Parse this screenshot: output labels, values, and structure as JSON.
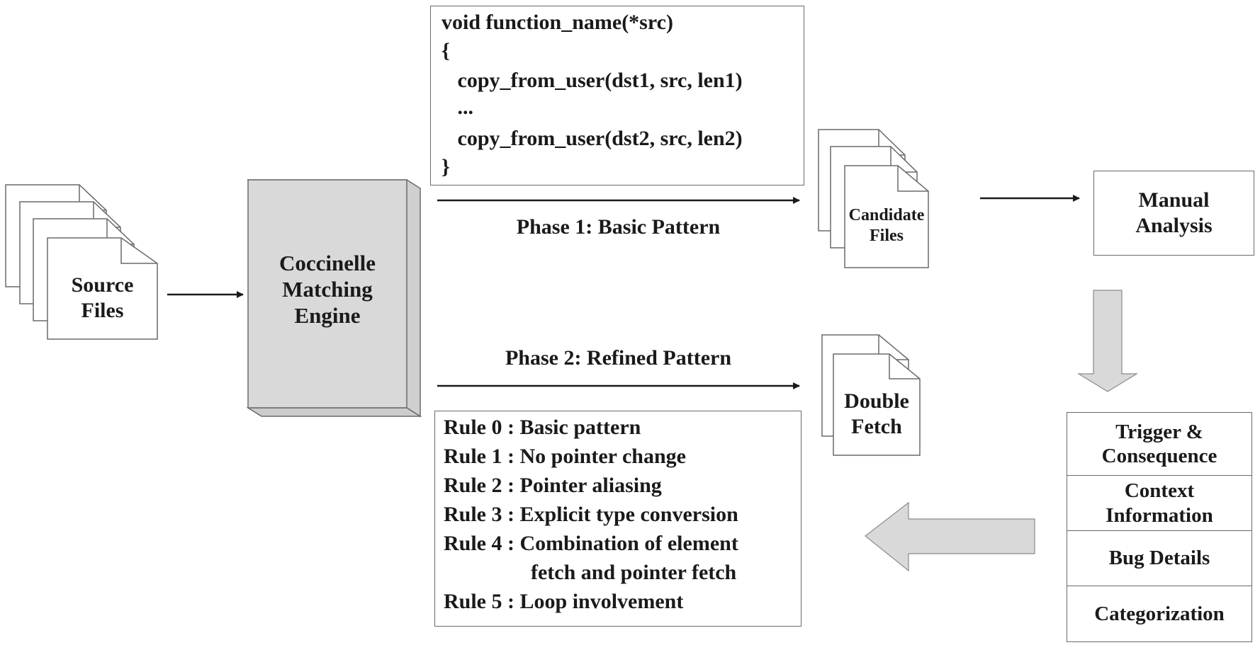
{
  "source_files": {
    "line1": "Source",
    "line2": "Files"
  },
  "engine": {
    "line1": "Coccinelle",
    "line2": "Matching",
    "line3": "Engine"
  },
  "basic_pattern_code": {
    "lines": [
      "void function_name(*src)",
      "{",
      "   copy_from_user(dst1, src, len1)",
      "   ...",
      "   copy_from_user(dst2, src, len2)",
      "}"
    ]
  },
  "phase1": {
    "label": "Phase 1: Basic Pattern"
  },
  "phase2": {
    "label": "Phase 2: Refined Pattern"
  },
  "candidate_files": {
    "line1": "Candidate",
    "line2": "Files"
  },
  "manual_analysis": {
    "line1": "Manual",
    "line2": "Analysis"
  },
  "double_fetch": {
    "line1": "Double",
    "line2": "Fetch"
  },
  "rules": {
    "items": [
      {
        "id": "Rule 0 :",
        "text": "Basic pattern"
      },
      {
        "id": "Rule 1 :",
        "text": "No pointer change"
      },
      {
        "id": "Rule 2 :",
        "text": "Pointer aliasing"
      },
      {
        "id": "Rule 3 :",
        "text": "Explicit type conversion"
      },
      {
        "id": "Rule 4 :",
        "text": "Combination of element"
      },
      {
        "id": "",
        "text": "fetch and pointer fetch"
      },
      {
        "id": "Rule 5 :",
        "text": "Loop involvement"
      }
    ]
  },
  "analysis_output": {
    "cells": [
      {
        "line1": "Trigger &",
        "line2": "Consequence"
      },
      {
        "line1": "Context",
        "line2": "Information"
      },
      {
        "line1": "Bug Details",
        "line2": ""
      },
      {
        "line1": "Categorization",
        "line2": ""
      }
    ]
  },
  "colors": {
    "engine_fill": "#d9d9d9",
    "block_arrow_fill": "#d9d9d9",
    "stroke": "#6a6a6a",
    "arrow": "#1a1a1a"
  }
}
